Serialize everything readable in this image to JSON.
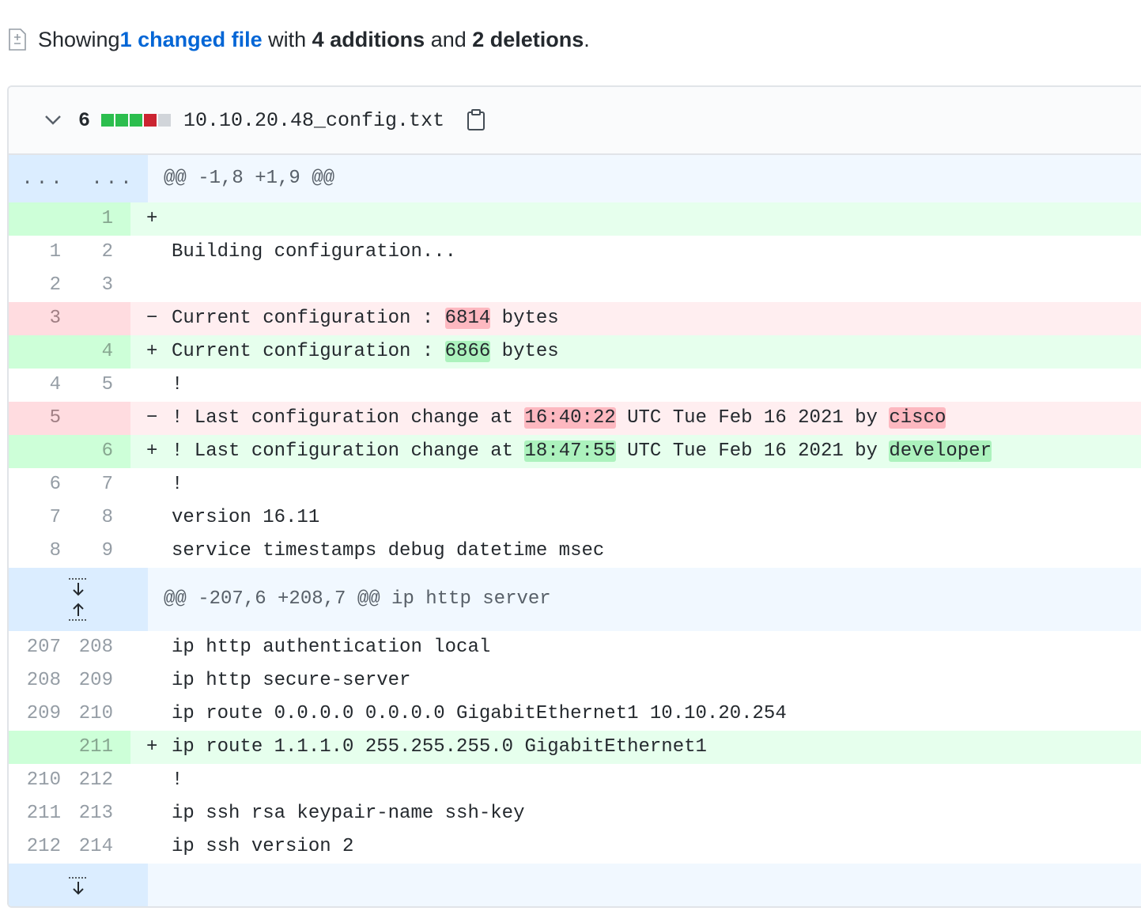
{
  "summary": {
    "prefix": "Showing ",
    "changed_link": "1 changed file",
    "with": " with ",
    "additions": "4 additions",
    "and": " and ",
    "deletions": "2 deletions",
    "suffix": "."
  },
  "file": {
    "change_count": "6",
    "filename": "10.10.20.48_config.txt",
    "diffstat": [
      "add",
      "add",
      "add",
      "del",
      "neutral"
    ],
    "colors": {
      "add": "#2cbe4e",
      "del": "#cb2431",
      "neutral": "#d1d5da"
    }
  },
  "hunks": [
    {
      "header": "@@ -1,8 +1,9 @@",
      "gutter_dots": "...",
      "lines": [
        {
          "type": "add",
          "old": "",
          "new": "1",
          "marker": "+",
          "text": ""
        },
        {
          "type": "ctx",
          "old": "1",
          "new": "2",
          "marker": " ",
          "text": "Building configuration..."
        },
        {
          "type": "ctx",
          "old": "2",
          "new": "3",
          "marker": " ",
          "text": ""
        },
        {
          "type": "del",
          "old": "3",
          "new": "",
          "marker": "-",
          "before": "Current configuration : ",
          "hl": "6814",
          "after": " bytes"
        },
        {
          "type": "add",
          "old": "",
          "new": "4",
          "marker": "+",
          "before": "Current configuration : ",
          "hl": "6866",
          "after": " bytes"
        },
        {
          "type": "ctx",
          "old": "4",
          "new": "5",
          "marker": " ",
          "text": "!"
        },
        {
          "type": "del",
          "old": "5",
          "new": "",
          "marker": "-",
          "before": "! Last configuration change at ",
          "hl": "16:40:22",
          "mid": " UTC Tue Feb 16 2021 by ",
          "hl2": "cisco"
        },
        {
          "type": "add",
          "old": "",
          "new": "6",
          "marker": "+",
          "before": "! Last configuration change at ",
          "hl": "18:47:55",
          "mid": " UTC Tue Feb 16 2021 by ",
          "hl2": "developer"
        },
        {
          "type": "ctx",
          "old": "6",
          "new": "7",
          "marker": " ",
          "text": "!"
        },
        {
          "type": "ctx",
          "old": "7",
          "new": "8",
          "marker": " ",
          "text": "version 16.11"
        },
        {
          "type": "ctx",
          "old": "8",
          "new": "9",
          "marker": " ",
          "text": "service timestamps debug datetime msec"
        }
      ]
    },
    {
      "header": "@@ -207,6 +208,7 @@ ip http server",
      "lines": [
        {
          "type": "ctx",
          "old": "207",
          "new": "208",
          "marker": " ",
          "text": "ip http authentication local"
        },
        {
          "type": "ctx",
          "old": "208",
          "new": "209",
          "marker": " ",
          "text": "ip http secure-server"
        },
        {
          "type": "ctx",
          "old": "209",
          "new": "210",
          "marker": " ",
          "text": "ip route 0.0.0.0 0.0.0.0 GigabitEthernet1 10.10.20.254"
        },
        {
          "type": "add",
          "old": "",
          "new": "211",
          "marker": "+",
          "text": "ip route 1.1.1.0 255.255.255.0 GigabitEthernet1"
        },
        {
          "type": "ctx",
          "old": "210",
          "new": "212",
          "marker": " ",
          "text": "!"
        },
        {
          "type": "ctx",
          "old": "211",
          "new": "213",
          "marker": " ",
          "text": "ip ssh rsa keypair-name ssh-key"
        },
        {
          "type": "ctx",
          "old": "212",
          "new": "214",
          "marker": " ",
          "text": "ip ssh version 2"
        }
      ]
    }
  ]
}
